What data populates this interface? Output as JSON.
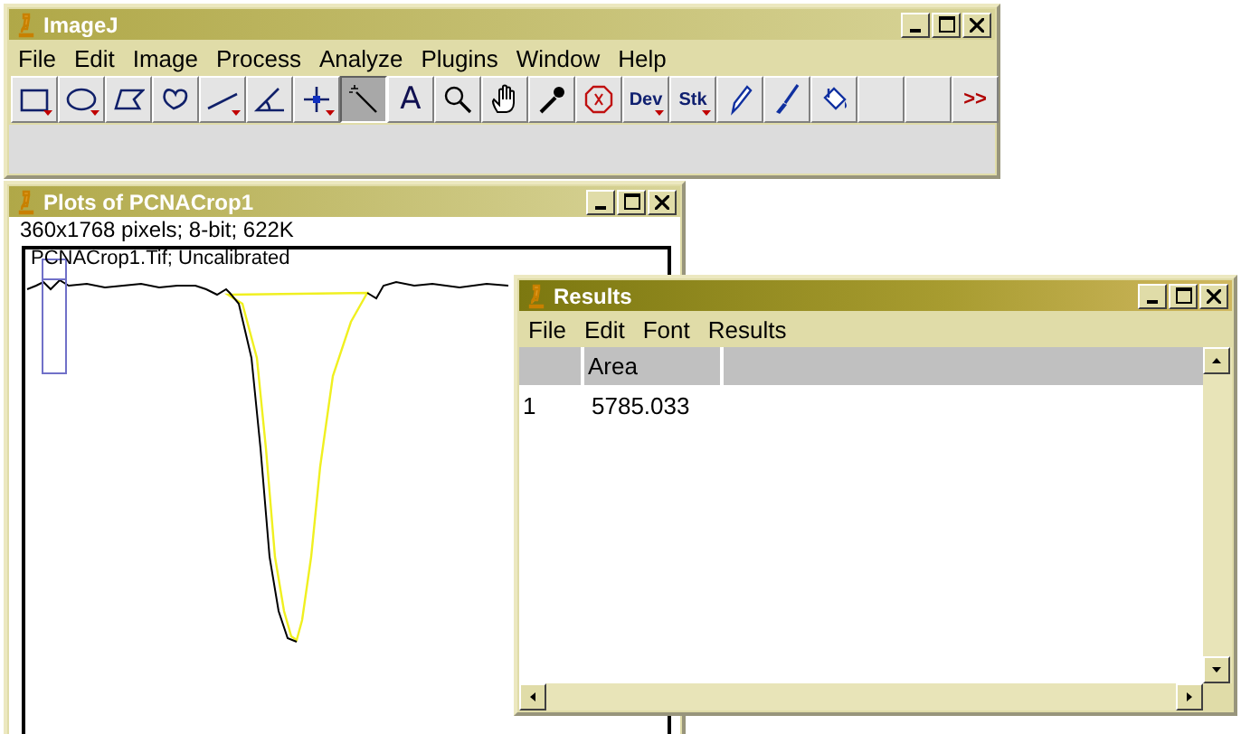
{
  "imagej_window": {
    "title": "ImageJ",
    "menu": [
      "File",
      "Edit",
      "Image",
      "Process",
      "Analyze",
      "Plugins",
      "Window",
      "Help"
    ],
    "tools": [
      {
        "kind": "rectangle",
        "has_menu": true,
        "selected": false
      },
      {
        "kind": "oval",
        "has_menu": true,
        "selected": false
      },
      {
        "kind": "polygon",
        "has_menu": false,
        "selected": false
      },
      {
        "kind": "freehand",
        "has_menu": false,
        "selected": false
      },
      {
        "kind": "line",
        "has_menu": true,
        "selected": false
      },
      {
        "kind": "angle",
        "has_menu": false,
        "selected": false
      },
      {
        "kind": "point",
        "has_menu": true,
        "selected": false
      },
      {
        "kind": "wand",
        "has_menu": false,
        "selected": true
      },
      {
        "kind": "text",
        "label": "A",
        "has_menu": false,
        "selected": false
      },
      {
        "kind": "magnifier",
        "has_menu": false,
        "selected": false
      },
      {
        "kind": "hand",
        "has_menu": false,
        "selected": false
      },
      {
        "kind": "dropper",
        "has_menu": false,
        "selected": false
      },
      {
        "kind": "stop",
        "has_menu": false,
        "selected": false
      },
      {
        "kind": "label",
        "label": "Dev",
        "has_menu": true,
        "selected": false
      },
      {
        "kind": "label",
        "label": "Stk",
        "has_menu": true,
        "selected": false
      },
      {
        "kind": "pencil",
        "has_menu": false,
        "selected": false
      },
      {
        "kind": "brush",
        "has_menu": false,
        "selected": false
      },
      {
        "kind": "bucket",
        "has_menu": false,
        "selected": false
      },
      {
        "kind": "empty",
        "has_menu": false,
        "selected": false
      },
      {
        "kind": "empty",
        "has_menu": false,
        "selected": false
      },
      {
        "kind": "more",
        "label": ">>",
        "has_menu": false,
        "selected": false
      }
    ]
  },
  "plot_window": {
    "title": "Plots of PCNACrop1",
    "info": "360x1768 pixels; 8-bit; 622K",
    "plot_label": "PCNACrop1.Tif; Uncalibrated"
  },
  "results_window": {
    "title": "Results",
    "menu": [
      "File",
      "Edit",
      "Font",
      "Results"
    ],
    "table": {
      "columns": [
        "Area"
      ],
      "rows": [
        {
          "index": "1",
          "cells": [
            "5785.033"
          ]
        }
      ]
    }
  }
}
